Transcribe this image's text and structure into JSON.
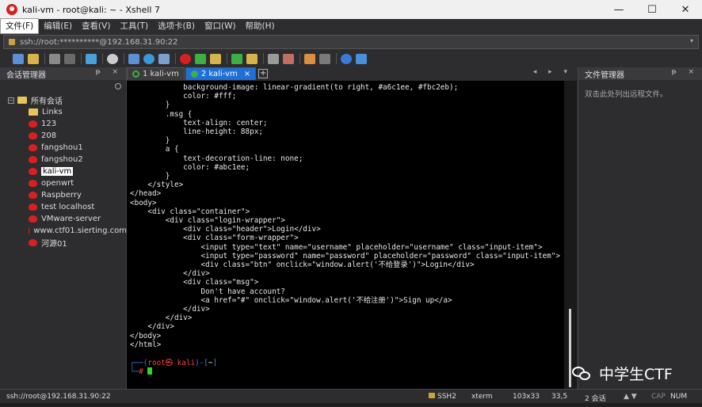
{
  "window": {
    "title": "kali-vm - root@kali: ~ - Xshell 7",
    "minimize": "—",
    "maximize": "☐",
    "close": "✕"
  },
  "menu": [
    "文件(F)",
    "编辑(E)",
    "查看(V)",
    "工具(T)",
    "选项卡(B)",
    "窗口(W)",
    "帮助(H)"
  ],
  "address": {
    "value": "ssh://root:**********@192.168.31.90:22",
    "dropdown": "▾"
  },
  "session_manager": {
    "title": "会话管理器",
    "controls": "ᵽ ×",
    "root_label": "所有会话",
    "items": [
      "Links",
      "123",
      "208",
      "fangshou1",
      "fangshou2",
      "kali-vm",
      "openwrt",
      "Raspberry",
      "test localhost",
      "VMware-server",
      "www.ctf01.sierting.com",
      "河源01"
    ],
    "selected": "kali-vm"
  },
  "tabs": [
    {
      "label": "1 kali-vm",
      "active": false
    },
    {
      "label": "2 kali-vm",
      "active": true
    }
  ],
  "tab_close": "×",
  "tab_add": "+",
  "tab_nav": "◂ ▸ ▾",
  "terminal": {
    "lines": [
      "            background-image: linear-gradient(to right, #a6c1ee, #fbc2eb);",
      "            color: #fff;",
      "        }",
      "        .msg {",
      "            text-align: center;",
      "            line-height: 88px;",
      "        }",
      "        a {",
      "            text-decoration-line: none;",
      "            color: #abc1ee;",
      "        }",
      "    </style>",
      "</head>",
      "<body>",
      "    <div class=\"container\">",
      "        <div class=\"login-wrapper\">",
      "            <div class=\"header\">Login</div>",
      "            <div class=\"form-wrapper\">",
      "                <input type=\"text\" name=\"username\" placeholder=\"username\" class=\"input-item\">",
      "                <input type=\"password\" name=\"password\" placeholder=\"password\" class=\"input-item\">",
      "                <div class=\"btn\" onclick=\"window.alert('不给登录')\">Login</div>",
      "            </div>",
      "            <div class=\"msg\">",
      "                Don't have account?",
      "                <a href=\"#\" onclick=\"window.alert('不给注册')\">Sign up</a>",
      "            </div>",
      "        </div>",
      "    </div>",
      "</body>",
      "</html>"
    ],
    "prompt_open": "┌──(",
    "prompt_user": "root㉿ kali",
    "prompt_close": ")-[",
    "prompt_path": "~",
    "prompt_end": "]",
    "prompt_second": "└─",
    "prompt_hash": "#"
  },
  "file_manager": {
    "title": "文件管理器",
    "controls": "ᵽ ×",
    "hint": "双击此处列出远程文件。"
  },
  "watermark": "中学生CTF",
  "status": {
    "connection": "ssh://root@192.168.31.90:22",
    "protocol": "SSH2",
    "terminal_type": "xterm",
    "size": "103x33",
    "cursor_pos": "33,5",
    "sessions": "2 会话",
    "caps": "CAP",
    "num": "NUM"
  },
  "colors": {
    "accent": "#1e6fd9",
    "session_icon": "#d82020",
    "folder": "#e8c45a",
    "prompt_blue": "#3f7fe6",
    "prompt_red": "#ff4040",
    "cursor": "#2ad92a"
  }
}
